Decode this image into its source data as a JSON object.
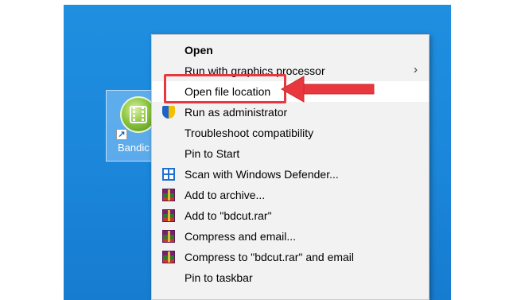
{
  "desktop": {
    "icon_label": "Bandic"
  },
  "context_menu": {
    "items": [
      {
        "label": "Open",
        "icon": "",
        "bold": true
      },
      {
        "label": "Run with graphics processor",
        "icon": "",
        "submenu": true
      },
      {
        "label": "Open file location",
        "icon": "",
        "highlighted": true
      },
      {
        "label": "Run as administrator",
        "icon": "uac-shield-icon"
      },
      {
        "label": "Troubleshoot compatibility",
        "icon": ""
      },
      {
        "label": "Pin to Start",
        "icon": ""
      },
      {
        "label": "Scan with Windows Defender...",
        "icon": "windows-defender-icon"
      },
      {
        "label": "Add to archive...",
        "icon": "winrar-icon"
      },
      {
        "label": "Add to \"bdcut.rar\"",
        "icon": "winrar-icon"
      },
      {
        "label": "Compress and email...",
        "icon": "winrar-icon"
      },
      {
        "label": "Compress to \"bdcut.rar\" and email",
        "icon": "winrar-icon"
      },
      {
        "label": "Pin to taskbar",
        "icon": ""
      }
    ],
    "submenu_glyph": "›"
  },
  "annotation": {
    "box_color": "#e8383d",
    "arrow_color": "#e8383d"
  }
}
